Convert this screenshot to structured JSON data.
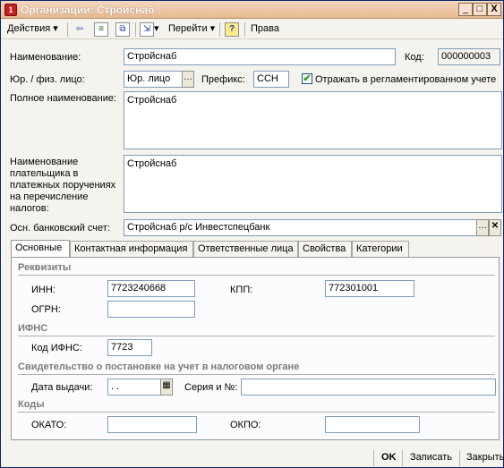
{
  "window": {
    "title": "Организации: Стройснаб",
    "minimize": "_",
    "maximize": "□",
    "close": "X"
  },
  "toolbar": {
    "actions_label": "Действия",
    "goto_label": "Перейти",
    "help_label": "?",
    "rights_label": "Права"
  },
  "form": {
    "name_label": "Наименование:",
    "name_value": "Стройснаб",
    "code_label": "Код:",
    "code_value": "000000003",
    "entity_type_label": "Юр. / физ. лицо:",
    "entity_type_value": "Юр. лицо",
    "prefix_label": "Префикс:",
    "prefix_value": "ССН",
    "reglament_label": "Отражать в регламентированном учете",
    "reglament_checked": true,
    "full_name_label": "Полное наименование:",
    "full_name_value": "Стройснаб",
    "payer_name_label_1": "Наименование",
    "payer_name_label_2": "плательщика в",
    "payer_name_label_3": "платежных поручениях",
    "payer_name_label_4": "на перечисление",
    "payer_name_label_5": "налогов:",
    "payer_name_value": "Стройснаб",
    "bank_account_label": "Осн. банковский счет:",
    "bank_account_value": "Стройснаб р/с Инвестспецбанк"
  },
  "tabs": [
    {
      "label": "Основные",
      "active": true
    },
    {
      "label": "Контактная информация",
      "active": false
    },
    {
      "label": "Ответственные лица",
      "active": false
    },
    {
      "label": "Свойства",
      "active": false
    },
    {
      "label": "Категории",
      "active": false
    }
  ],
  "main_tab": {
    "requisites_group": "Реквизиты",
    "inn_label": "ИНН:",
    "inn_value": "7723240668",
    "kpp_label": "КПП:",
    "kpp_value": "772301001",
    "ogrn_label": "ОГРН:",
    "ogrn_value": "",
    "ifns_group": "ИФНС",
    "ifns_code_label": "Код ИФНС:",
    "ifns_code_value": "7723",
    "certificate_group": "Свидетельство о постановке на учет в налоговом органе",
    "issue_date_label": "Дата выдачи:",
    "issue_date_value": " .  .",
    "series_label": "Серия и №:",
    "series_value": "",
    "codes_group": "Коды",
    "okato_label": "ОКАТО:",
    "okato_value": "",
    "okpo_label": "ОКПО:",
    "okpo_value": ""
  },
  "footer": {
    "ok_label": "OK",
    "save_label": "Записать",
    "close_label": "Закрыть"
  }
}
